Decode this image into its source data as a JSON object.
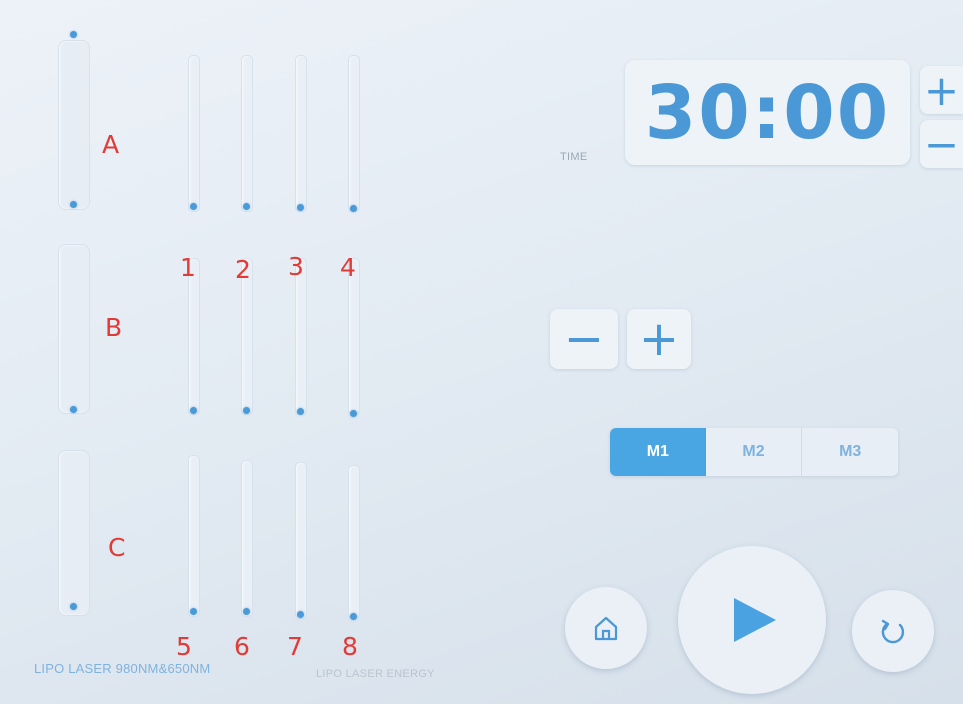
{
  "channels": {
    "zones": [
      "A",
      "B",
      "C"
    ],
    "numbers_top": [
      "1",
      "2",
      "3",
      "4"
    ],
    "numbers_bottom": [
      "5",
      "6",
      "7",
      "8"
    ]
  },
  "captions": {
    "lipo_laser": "LIPO LASER 980NM&650NM",
    "energy": "LIPO LASER ENERGY"
  },
  "time": {
    "label": "TIME",
    "value": "30:00",
    "increase": "+",
    "decrease": "−"
  },
  "energy_controls": {
    "decrease": "−",
    "increase": "+"
  },
  "modes": {
    "items": [
      "M1",
      "M2",
      "M3"
    ],
    "selected": "M1"
  },
  "icons": {
    "home": "home-icon",
    "play": "play-icon",
    "reset": "refresh-icon"
  },
  "colors": {
    "accent": "#4a98d6",
    "active_mode": "#4aa6e2",
    "annotation": "#e23a36"
  }
}
